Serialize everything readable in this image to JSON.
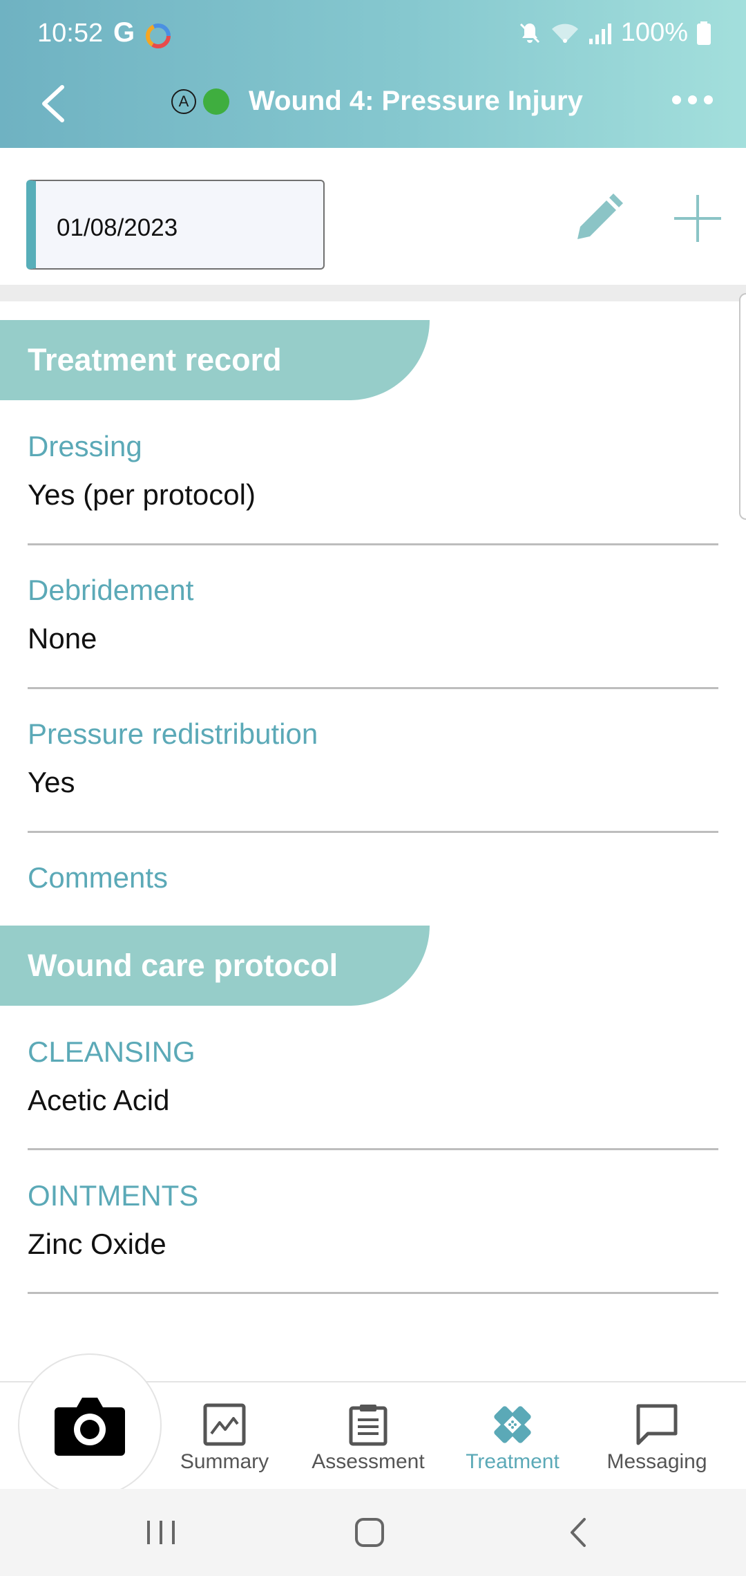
{
  "status_bar": {
    "time": "10:52",
    "g_label": "G",
    "battery": "100%"
  },
  "header": {
    "auto_badge": "A",
    "title": "Wound 4: Pressure Injury",
    "status_dot_color": "#3fae3f"
  },
  "toolbar": {
    "date": "01/08/2023"
  },
  "sections": {
    "treatment": {
      "title": "Treatment record",
      "fields": [
        {
          "label": "Dressing",
          "value": "Yes (per protocol)"
        },
        {
          "label": "Debridement",
          "value": "None"
        },
        {
          "label": "Pressure redistribution",
          "value": "Yes"
        },
        {
          "label": "Comments",
          "value": ""
        }
      ]
    },
    "protocol": {
      "title": "Wound care protocol",
      "fields": [
        {
          "label": "CLEANSING",
          "value": "Acetic Acid"
        },
        {
          "label": "OINTMENTS",
          "value": "Zinc Oxide"
        }
      ]
    }
  },
  "bottom_nav": {
    "items": [
      {
        "label": "Summary",
        "icon": "chart-icon"
      },
      {
        "label": "Assessment",
        "icon": "clipboard-icon"
      },
      {
        "label": "Treatment",
        "icon": "bandage-icon",
        "active": true
      },
      {
        "label": "Messaging",
        "icon": "message-icon"
      }
    ]
  },
  "colors": {
    "accent": "#5ba9b7",
    "section_header": "#96cdc9",
    "header_gradient_start": "#6fb2c2",
    "header_gradient_end": "#a3dfdc"
  }
}
